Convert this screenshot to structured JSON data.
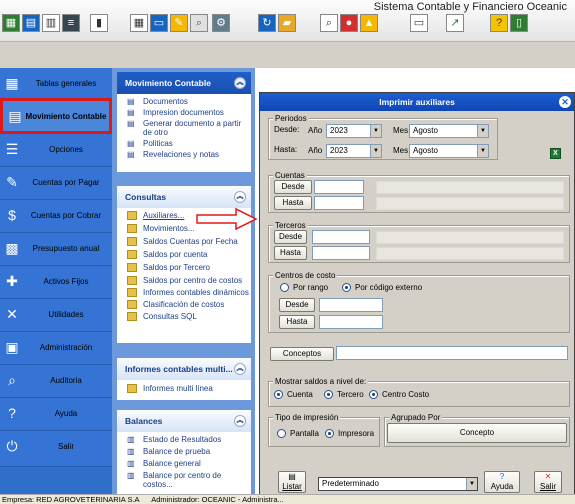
{
  "app": {
    "title": "Sistema Contable y Financiero Oceanic"
  },
  "toolbar": {
    "icons": [
      "grid-icon",
      "table-icon",
      "document-icon",
      "report-icon",
      "barchart-icon",
      "calendar-icon",
      "print-icon",
      "edit-icon",
      "search-icon",
      "settings-icon",
      "refresh-icon",
      "monitor-icon",
      "chart-icon",
      "help-icon",
      "exit-icon"
    ]
  },
  "left_nav": {
    "items": [
      {
        "label": "Tablas generales",
        "icon": "tables-icon"
      },
      {
        "label": "Movimiento Contable",
        "icon": "ledger-icon",
        "active": true
      },
      {
        "label": "Opciones",
        "icon": "options-icon"
      },
      {
        "label": "Cuentas por Pagar",
        "icon": "payables-icon"
      },
      {
        "label": "Cuentas por Cobrar",
        "icon": "money-icon"
      },
      {
        "label": "Presupuesto anual",
        "icon": "budget-icon"
      },
      {
        "label": "Activos Fijos",
        "icon": "assets-icon"
      },
      {
        "label": "Utilidades",
        "icon": "tools-icon"
      },
      {
        "label": "Administración",
        "icon": "admin-icon"
      },
      {
        "label": "Auditoria",
        "icon": "audit-icon"
      },
      {
        "label": "Ayuda",
        "icon": "help-icon"
      },
      {
        "label": "Salir",
        "icon": "power-icon"
      }
    ]
  },
  "middle_panel": {
    "movimiento": {
      "header": "Movimiento Contable",
      "items": [
        "Documentos",
        "Impresion documentos",
        "Generar documento a partir de otro",
        "Politicas",
        "Revelaciones y notas"
      ]
    },
    "consultas": {
      "header": "Consultas",
      "items": [
        "Auxiliares...",
        "Movimientos...",
        "Saldos Cuentas por Fecha",
        "Saldos por cuenta",
        "Saldos por Tercero",
        "Saldos por centro de costos",
        "Informes contables dinámicos",
        "Clasificación de costos",
        "Consultas SQL"
      ]
    },
    "informes": {
      "header": "Informes contables multi...",
      "items": [
        "Informes multi línea"
      ]
    },
    "balances": {
      "header": "Balances",
      "items": [
        "Estado de Resultados",
        "Balance de prueba",
        "Balance general",
        "Balance por centro de costos..."
      ]
    }
  },
  "dialog": {
    "title": "Imprimir auxiliares",
    "periodos": {
      "legend": "Periodos",
      "desde_label": "Desde:",
      "hasta_label": "Hasta:",
      "ano_label": "Año",
      "mes_label": "Mes",
      "desde_ano": "2023",
      "desde_mes": "Agosto",
      "hasta_ano": "2023",
      "hasta_mes": "Agosto"
    },
    "cuentas": {
      "legend": "Cuentas",
      "desde": "Desde",
      "hasta": "Hasta"
    },
    "terceros": {
      "legend": "Terceros",
      "desde": "Desde",
      "hasta": "Hasta"
    },
    "centros": {
      "legend": "Centros de costo",
      "por_rango": "Por rango",
      "por_codigo": "Por código externo",
      "selected": "Por código externo",
      "desde": "Desde",
      "hasta": "Hasta"
    },
    "conceptos_button": "Conceptos",
    "mostrar": {
      "legend": "Mostrar saldos a nivel de:",
      "options": [
        "Cuenta",
        "Tercero",
        "Centro Costo"
      ]
    },
    "tipo": {
      "legend": "Tipo de impresión",
      "pantalla": "Pantalla",
      "impresora": "Impresora",
      "selected": "Impresora"
    },
    "agrupado": {
      "legend": "Agrupado Por",
      "button": "Concepto"
    },
    "footer": {
      "listar": "Listar",
      "template": "Predeterminado",
      "ayuda": "Ayuda",
      "salir": "Salir"
    }
  },
  "status_bar": {
    "empresa": "Empresa: RED AGROVETERINARIA S.A",
    "administrador": "Administrador: OCEANIC - Administra..."
  }
}
